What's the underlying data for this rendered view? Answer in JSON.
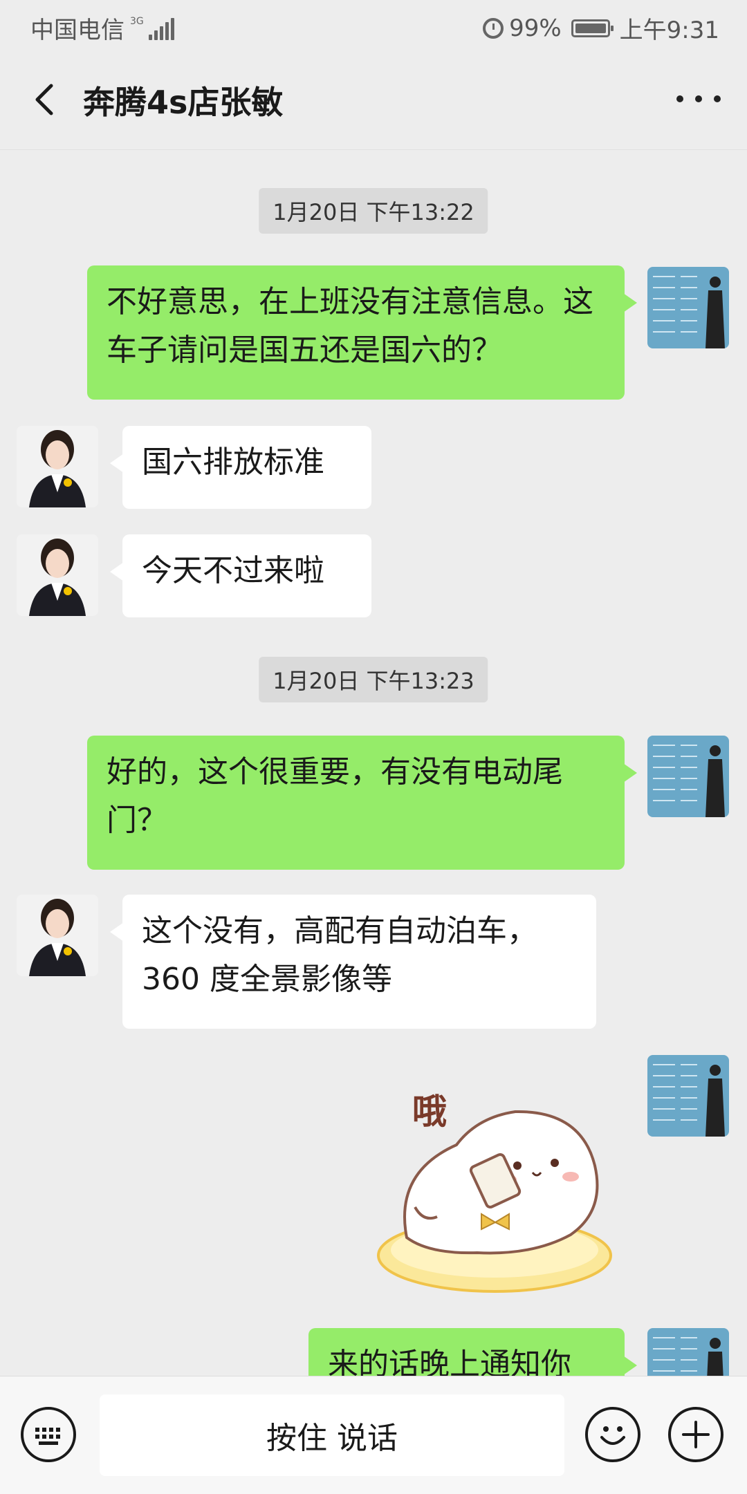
{
  "status_bar": {
    "carrier": "中国电信",
    "network": "3G",
    "battery_percent": "99%",
    "time": "上午9:31"
  },
  "header": {
    "title": "奔腾4s店张敏"
  },
  "messages": [
    {
      "type": "timestamp",
      "text": "1月20日 下午13:22"
    },
    {
      "type": "me",
      "text": "不好意思，在上班没有注意信息。这车子请问是国五还是国六的？"
    },
    {
      "type": "other",
      "text": "国六排放标准"
    },
    {
      "type": "other",
      "text": "今天不过来啦"
    },
    {
      "type": "timestamp",
      "text": "1月20日 下午13:23"
    },
    {
      "type": "me",
      "text": "好的，这个很重要，有没有电动尾门？"
    },
    {
      "type": "other",
      "text": "这个没有，高配有自动泊车，360 度全景影像等"
    },
    {
      "type": "me_sticker",
      "sticker_text": "哦"
    },
    {
      "type": "me",
      "text": "来的话晚上通知你"
    }
  ],
  "input_bar": {
    "hold_to_talk_label": "按住 说话"
  },
  "colors": {
    "background": "#ededed",
    "my_bubble": "#95ec69",
    "other_bubble": "#ffffff"
  },
  "icons": {
    "back": "back-arrow-icon",
    "more": "more-dots-icon",
    "keyboard": "keyboard-icon",
    "emoji": "emoji-icon",
    "plus": "plus-icon"
  }
}
